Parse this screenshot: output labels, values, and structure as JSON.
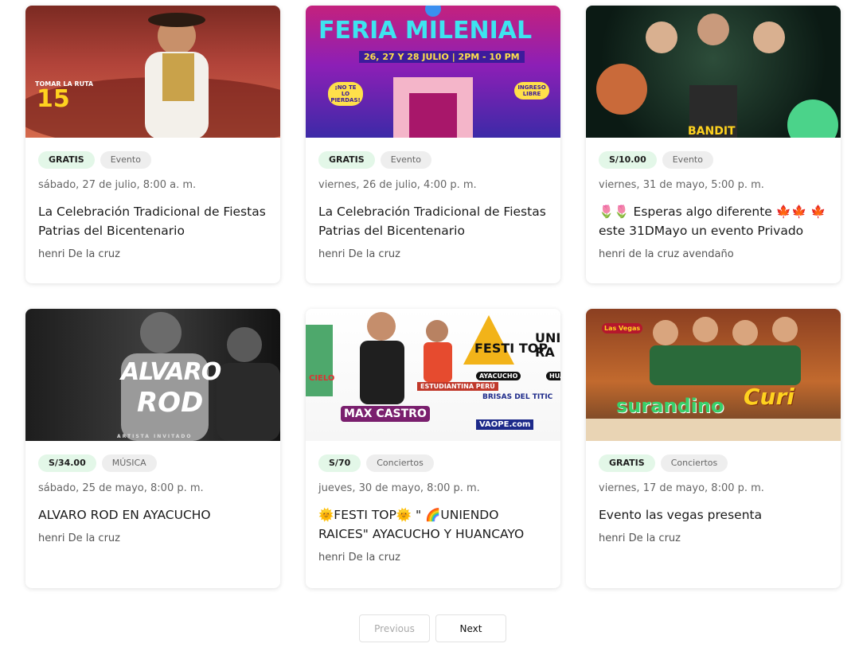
{
  "events": [
    {
      "price": "GRATIS",
      "category": "Evento",
      "date": "sábado, 27 de julio, 8:00 a. m.",
      "title": "La Celebración Tradicional de Fiestas Patrias del Bicentenario",
      "author": "henri De la cruz",
      "image_text": [
        "TOMAR LA RUTA",
        "15"
      ]
    },
    {
      "price": "GRATIS",
      "category": "Evento",
      "date": "viernes, 26 de julio, 4:00 p. m.",
      "title": "La Celebración Tradicional de Fiestas Patrias del Bicentenario",
      "author": "henri De la cruz",
      "image_text": [
        "FERIA MILENIAL",
        "26, 27 Y 28 JULIO | 2PM - 10 PM",
        "¡NO TE LO PIERDAS!",
        "INGRESO LIBRE"
      ]
    },
    {
      "price": "S/10.00",
      "category": "Evento",
      "date": "viernes, 31 de mayo, 5:00 p. m.",
      "title": "🌷🌷 Esperas algo diferente 🍁🍁 🍁 este 31DMayo un evento Privado",
      "author": "henri de la cruz avendaño",
      "image_text": [
        "BANDIT"
      ]
    },
    {
      "price": "S/34.00",
      "category": "MÚSICA",
      "date": "sábado, 25 de mayo, 8:00 p. m.",
      "title": "ALVARO ROD EN AYACUCHO",
      "author": "henri De la cruz",
      "image_text": [
        "ALVARO",
        "ROD",
        "ARTISTA INVITADO"
      ]
    },
    {
      "price": "S/70",
      "category": "Conciertos",
      "date": "jueves, 30 de mayo, 8:00 p. m.",
      "title": "🌞FESTI TOP🌞 \" 🌈UNIENDO RAICES\" AYACUCHO Y HUANCAYO",
      "author": "henri De la cruz",
      "image_text": [
        "FESTI TOP",
        "UNI RA",
        "AYACUCHO",
        "HUA",
        "ESTUDIANTINA PERÚ",
        "MAX CASTRO",
        "BRISAS DEL TITIC",
        "VAOPE.com",
        "CIELO"
      ]
    },
    {
      "price": "GRATIS",
      "category": "Conciertos",
      "date": "viernes, 17 de mayo, 8:00 p. m.",
      "title": "Evento las vegas presenta",
      "author": "henri De la cruz",
      "image_text": [
        "surandino",
        "Curi",
        "Las Vegas"
      ]
    }
  ],
  "pagination": {
    "previous": "Previous",
    "next": "Next"
  },
  "colors": {
    "price_tag_bg": "#e3f7e8",
    "category_tag_bg": "#eeeeee",
    "card_bg": "#ffffff"
  }
}
